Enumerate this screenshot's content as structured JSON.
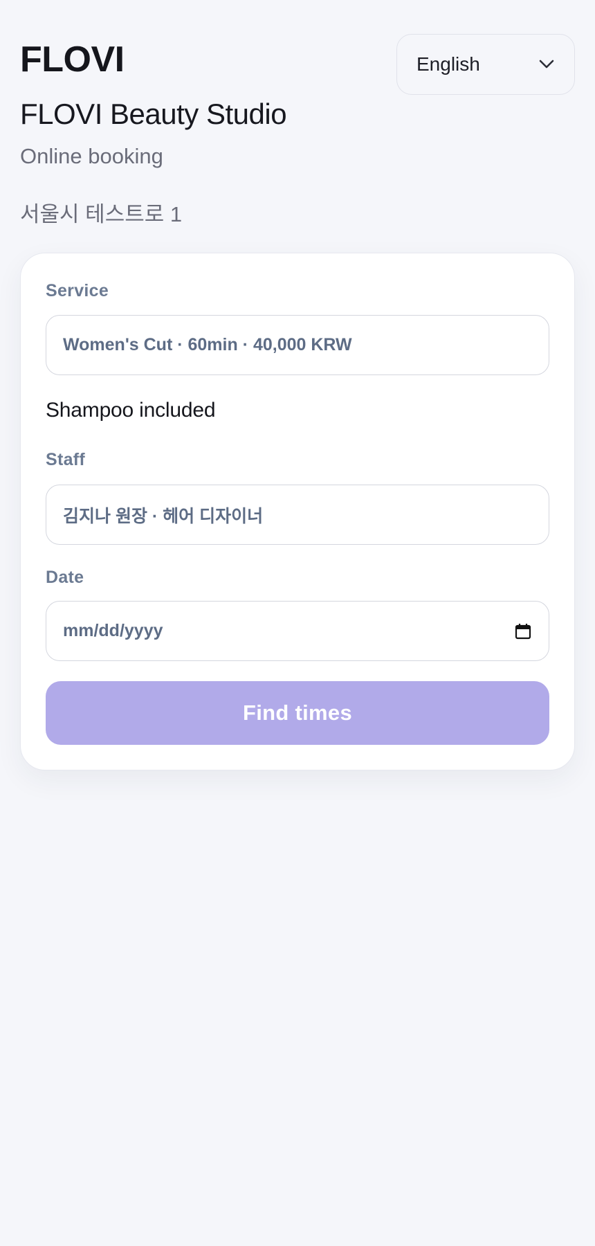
{
  "header": {
    "logo": "FLOVI",
    "studio_name": "FLOVI Beauty Studio",
    "subtitle": "Online booking",
    "address": "서울시 테스트로 1",
    "language": {
      "selected": "English"
    }
  },
  "form": {
    "service": {
      "label": "Service",
      "value": "Women's Cut · 60min · 40,000 KRW",
      "note": "Shampoo included"
    },
    "staff": {
      "label": "Staff",
      "value": "김지나 원장 · 헤어 디자이너"
    },
    "date": {
      "label": "Date",
      "placeholder": "mm/dd/yyyy"
    },
    "submit_label": "Find times"
  },
  "icons": {
    "language_dropdown": "chevron-down-icon",
    "date_picker": "calendar-icon"
  },
  "colors": {
    "background": "#f5f6fa",
    "card": "#ffffff",
    "label": "#6b7a92",
    "button_disabled": "#b1aae9"
  }
}
